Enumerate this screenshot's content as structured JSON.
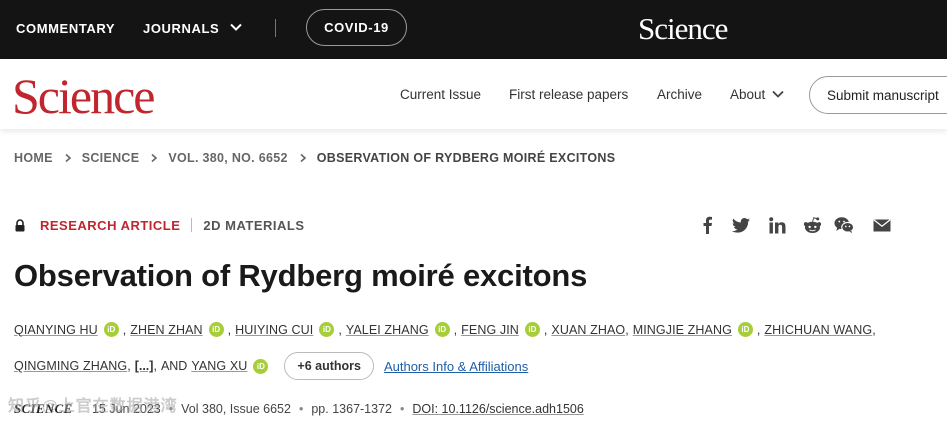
{
  "topbar": {
    "commentary": "COMMENTARY",
    "journals": "JOURNALS",
    "covid": "COVID-19",
    "brand": "Science"
  },
  "header": {
    "logo": "Science",
    "nav": [
      "Current Issue",
      "First release papers",
      "Archive",
      "About"
    ],
    "submit": "Submit manuscript"
  },
  "breadcrumb": [
    "HOME",
    "SCIENCE",
    "VOL. 380, NO. 6652",
    "OBSERVATION OF RYDBERG MOIRÉ EXCITONS"
  ],
  "meta": {
    "article_type": "RESEARCH ARTICLE",
    "subject": "2D MATERIALS"
  },
  "share_icons": [
    "facebook-icon",
    "twitter-icon",
    "linkedin-icon",
    "reddit-icon",
    "wechat-icon",
    "email-icon"
  ],
  "title": "Observation of Rydberg moiré excitons",
  "authors": {
    "row1": [
      "QIANYING HU",
      "ZHEN ZHAN",
      "HUIYING CUI",
      "YALEI ZHANG",
      "FENG JIN",
      "XUAN ZHAO",
      "MINGJIE ZHANG",
      "ZHICHUAN WANG"
    ],
    "row2_first": "QINGMING ZHANG",
    "ellipsis": "[...]",
    "and": "AND",
    "last": "YANG XU",
    "more_button": "+6 authors",
    "affiliations_link": "Authors Info & Affiliations",
    "orcid_label": "iD"
  },
  "citation": {
    "journal": "SCIENCE",
    "date": "15 Jun 2023",
    "volume": "Vol 380, Issue 6652",
    "pages": "pp. 1367-1372",
    "doi": "DOI: 10.1126/science.adh1506"
  },
  "watermark": "知乎@上官在数据港湾",
  "colors": {
    "brand_red": "#c0262d",
    "topbar_bg": "#141414",
    "orcid_green": "#a6ce39",
    "link_blue": "#1f5fa8"
  }
}
